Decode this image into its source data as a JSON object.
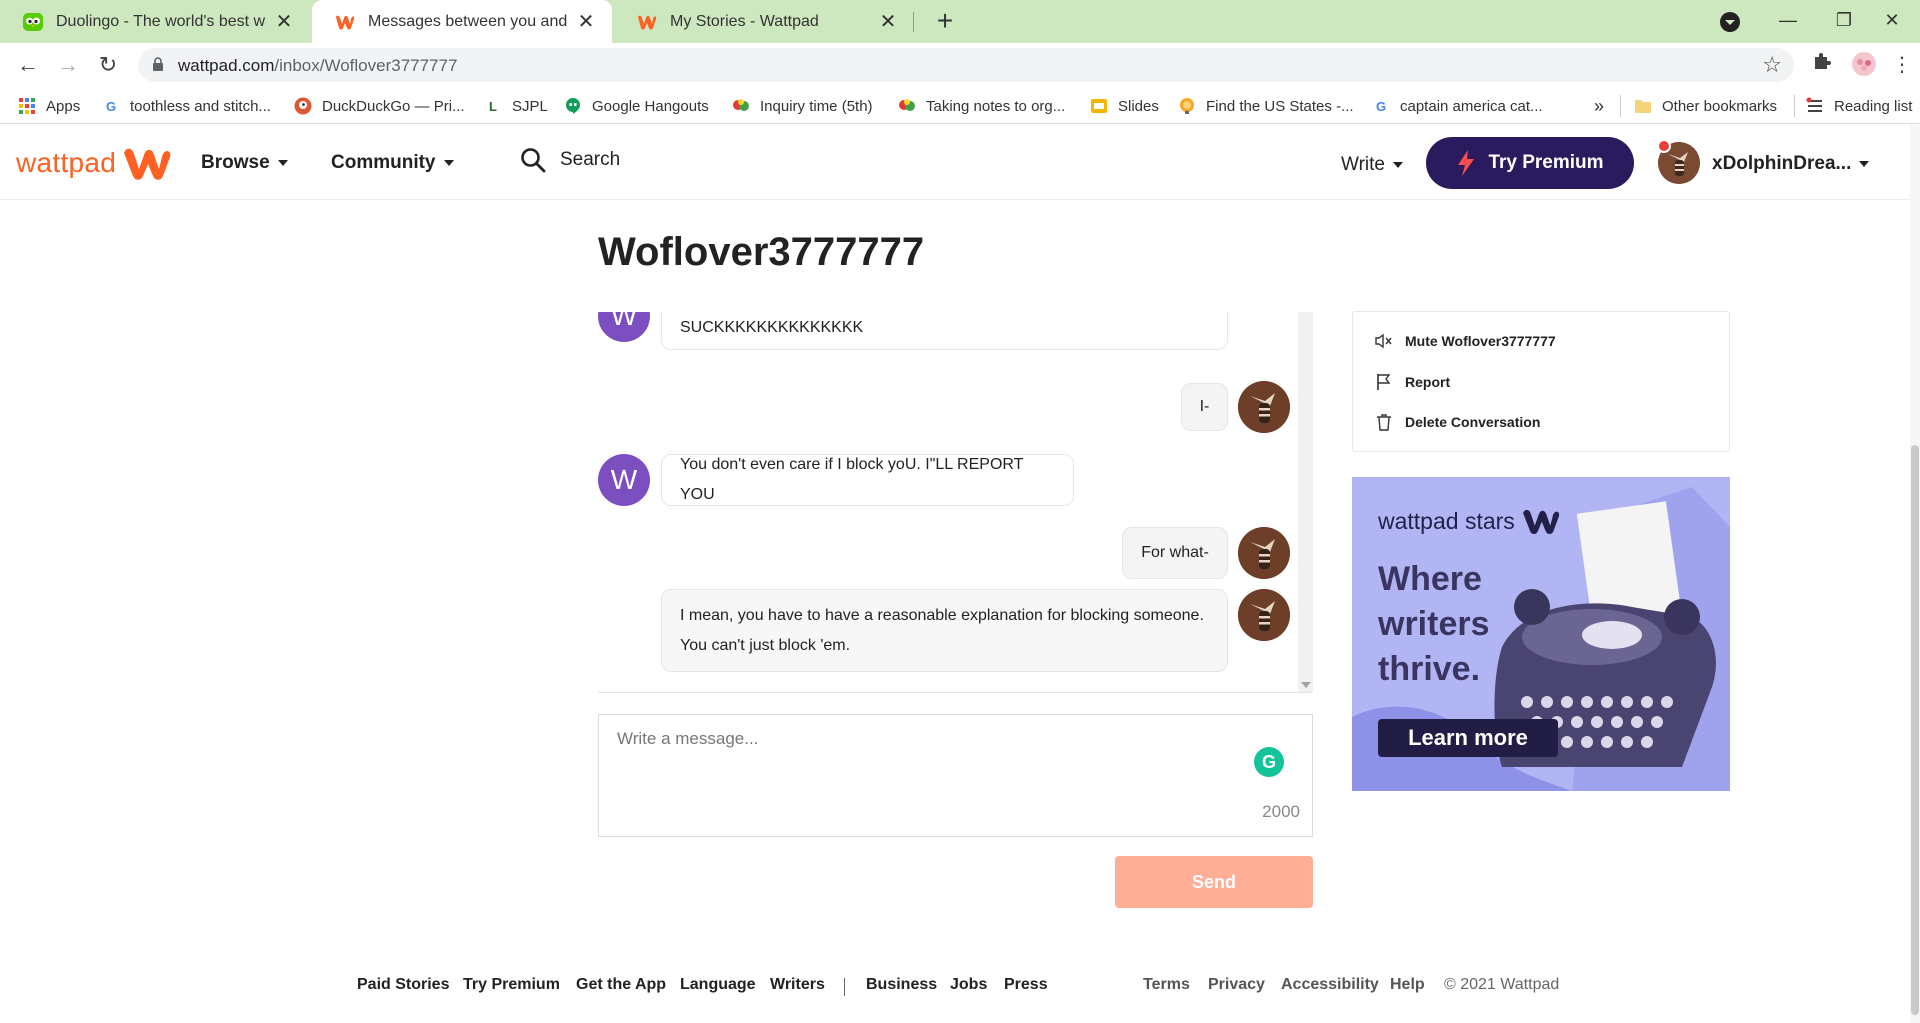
{
  "browser": {
    "tabs": [
      {
        "title": "Duolingo - The world's best way",
        "icon": "duolingo-owl-icon"
      },
      {
        "title": "Messages between you and Wof",
        "icon": "wattpad-icon"
      },
      {
        "title": "My Stories - Wattpad",
        "icon": "wattpad-icon"
      }
    ],
    "url_host": "wattpad.com",
    "url_path": "/inbox/Woflover3777777",
    "bookmarks": [
      {
        "label": "Apps",
        "icon": "apps-grid-icon"
      },
      {
        "label": "toothless and stitch...",
        "icon": "google-icon"
      },
      {
        "label": "DuckDuckGo — Pri...",
        "icon": "duckduckgo-icon"
      },
      {
        "label": "SJPL",
        "icon": "sjpl-icon"
      },
      {
        "label": "Google Hangouts",
        "icon": "hangouts-icon"
      },
      {
        "label": "Inquiry time (5th)",
        "icon": "thought-bubble-icon"
      },
      {
        "label": "Taking notes to org...",
        "icon": "thought-bubble-icon"
      },
      {
        "label": "Slides",
        "icon": "slides-icon"
      },
      {
        "label": "Find the US States -...",
        "icon": "globe-icon"
      },
      {
        "label": "captain america cat...",
        "icon": "google-icon"
      }
    ],
    "overflow": "»",
    "other_bookmarks": "Other bookmarks",
    "reading_list": "Reading list"
  },
  "header": {
    "logo_text": "wattpad",
    "browse": "Browse",
    "community": "Community",
    "search": "Search",
    "write": "Write",
    "premium": "Try Premium",
    "username": "xDolphinDrea..."
  },
  "conversation": {
    "title": "Woflover3777777",
    "partner_initial": "W",
    "messages": [
      {
        "from": "them",
        "text": "SUCKKKKKKKKKKKKKK"
      },
      {
        "from": "me",
        "text": "I-"
      },
      {
        "from": "them",
        "text": "You don't even care if I block yoU. I\"LL REPORT YOU"
      },
      {
        "from": "me",
        "text": "For what-"
      },
      {
        "from": "me",
        "text": "I mean, you have to have a reasonable explanation for blocking someone. You can't just block 'em."
      }
    ],
    "composer_placeholder": "Write a message...",
    "char_counter": "2000",
    "send": "Send"
  },
  "options": {
    "mute": "Mute Woflover3777777",
    "report": "Report",
    "delete": "Delete Conversation"
  },
  "ad": {
    "brand": "wattpad stars",
    "headline": "Where writers thrive.",
    "cta": "Learn more"
  },
  "footer": {
    "links_left": [
      "Paid Stories",
      "Try Premium",
      "Get the App",
      "Language",
      "Writers"
    ],
    "links_mid": [
      "Business",
      "Jobs",
      "Press"
    ],
    "links_right": [
      "Terms",
      "Privacy",
      "Accessibility",
      "Help"
    ],
    "copyright": "© 2021 Wattpad"
  },
  "colors": {
    "brand_orange": "#ff6122",
    "premium_purple": "#2a1b5e",
    "tabstrip_green": "#cde7bf",
    "avatar_purple": "#7c4fc1",
    "send_disabled": "#ffae95"
  }
}
